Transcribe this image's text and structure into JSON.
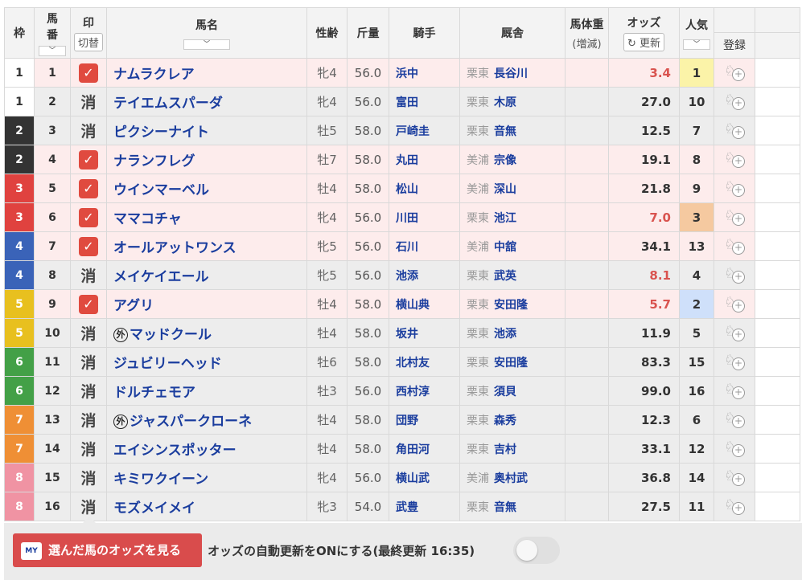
{
  "headers": {
    "waku": "枠",
    "umaban_1": "馬",
    "umaban_2": "番",
    "mark": "印",
    "mark_toggle": "切替",
    "name": "馬名",
    "sexage": "性齢",
    "weight": "斤量",
    "jockey": "騎手",
    "stable": "厩舎",
    "body_weight": "馬体重",
    "body_weight_sub": "(増減)",
    "odds": "オッズ",
    "odds_refresh": "更新",
    "ninki": "人気",
    "register": "登録"
  },
  "sort_arrow": "﹀",
  "refresh_icon": "↻",
  "check_glyph": "✓",
  "gai_glyph": "外",
  "horse_glyph": "♘",
  "plus_glyph": "+",
  "colors": {
    "waku": {
      "1": "#ffffff",
      "2": "#333333",
      "3": "#e0423f",
      "4": "#3a63b8",
      "5": "#e8c01f",
      "6": "#43a047",
      "7": "#ef8f35",
      "8": "#f093a3"
    },
    "mark_check": "#e04a3f",
    "odds_hot": "#d9534f",
    "ninki_1": "#fbf3a8",
    "ninki_2": "#cfe0fa",
    "ninki_3": "#f5c9a0"
  },
  "horses": [
    {
      "waku": "1",
      "num": "1",
      "mark": "check",
      "name": "ナムラクレア",
      "foreign": false,
      "sexage": "牝4",
      "weight": "56.0",
      "jockey": "浜中",
      "loc": "栗東",
      "trainer": "長谷川",
      "odds": "3.4",
      "hot": true,
      "ninki": "1"
    },
    {
      "waku": "1",
      "num": "2",
      "mark": "消",
      "name": "テイエムスパーダ",
      "foreign": false,
      "sexage": "牝4",
      "weight": "56.0",
      "jockey": "富田",
      "loc": "栗東",
      "trainer": "木原",
      "odds": "27.0",
      "hot": false,
      "ninki": "10"
    },
    {
      "waku": "2",
      "num": "3",
      "mark": "消",
      "name": "ピクシーナイト",
      "foreign": false,
      "sexage": "牡5",
      "weight": "58.0",
      "jockey": "戸崎圭",
      "loc": "栗東",
      "trainer": "音無",
      "odds": "12.5",
      "hot": false,
      "ninki": "7"
    },
    {
      "waku": "2",
      "num": "4",
      "mark": "check",
      "name": "ナランフレグ",
      "foreign": false,
      "sexage": "牡7",
      "weight": "58.0",
      "jockey": "丸田",
      "loc": "美浦",
      "trainer": "宗像",
      "odds": "19.1",
      "hot": false,
      "ninki": "8"
    },
    {
      "waku": "3",
      "num": "5",
      "mark": "check",
      "name": "ウインマーベル",
      "foreign": false,
      "sexage": "牡4",
      "weight": "58.0",
      "jockey": "松山",
      "loc": "美浦",
      "trainer": "深山",
      "odds": "21.8",
      "hot": false,
      "ninki": "9"
    },
    {
      "waku": "3",
      "num": "6",
      "mark": "check",
      "name": "ママコチャ",
      "foreign": false,
      "sexage": "牝4",
      "weight": "56.0",
      "jockey": "川田",
      "loc": "栗東",
      "trainer": "池江",
      "odds": "7.0",
      "hot": true,
      "ninki": "3"
    },
    {
      "waku": "4",
      "num": "7",
      "mark": "check",
      "name": "オールアットワンス",
      "foreign": false,
      "sexage": "牝5",
      "weight": "56.0",
      "jockey": "石川",
      "loc": "美浦",
      "trainer": "中舘",
      "odds": "34.1",
      "hot": false,
      "ninki": "13"
    },
    {
      "waku": "4",
      "num": "8",
      "mark": "消",
      "name": "メイケイエール",
      "foreign": false,
      "sexage": "牝5",
      "weight": "56.0",
      "jockey": "池添",
      "loc": "栗東",
      "trainer": "武英",
      "odds": "8.1",
      "hot": true,
      "ninki": "4"
    },
    {
      "waku": "5",
      "num": "9",
      "mark": "check",
      "name": "アグリ",
      "foreign": false,
      "sexage": "牡4",
      "weight": "58.0",
      "jockey": "横山典",
      "loc": "栗東",
      "trainer": "安田隆",
      "odds": "5.7",
      "hot": true,
      "ninki": "2"
    },
    {
      "waku": "5",
      "num": "10",
      "mark": "消",
      "name": "マッドクール",
      "foreign": true,
      "sexage": "牡4",
      "weight": "58.0",
      "jockey": "坂井",
      "loc": "栗東",
      "trainer": "池添",
      "odds": "11.9",
      "hot": false,
      "ninki": "5"
    },
    {
      "waku": "6",
      "num": "11",
      "mark": "消",
      "name": "ジュビリーヘッド",
      "foreign": false,
      "sexage": "牡6",
      "weight": "58.0",
      "jockey": "北村友",
      "loc": "栗東",
      "trainer": "安田隆",
      "odds": "83.3",
      "hot": false,
      "ninki": "15"
    },
    {
      "waku": "6",
      "num": "12",
      "mark": "消",
      "name": "ドルチェモア",
      "foreign": false,
      "sexage": "牡3",
      "weight": "56.0",
      "jockey": "西村淳",
      "loc": "栗東",
      "trainer": "須貝",
      "odds": "99.0",
      "hot": false,
      "ninki": "16"
    },
    {
      "waku": "7",
      "num": "13",
      "mark": "消",
      "name": "ジャスパークローネ",
      "foreign": true,
      "sexage": "牡4",
      "weight": "58.0",
      "jockey": "団野",
      "loc": "栗東",
      "trainer": "森秀",
      "odds": "12.3",
      "hot": false,
      "ninki": "6"
    },
    {
      "waku": "7",
      "num": "14",
      "mark": "消",
      "name": "エイシンスポッター",
      "foreign": false,
      "sexage": "牡4",
      "weight": "58.0",
      "jockey": "角田河",
      "loc": "栗東",
      "trainer": "吉村",
      "odds": "33.1",
      "hot": false,
      "ninki": "12"
    },
    {
      "waku": "8",
      "num": "15",
      "mark": "消",
      "name": "キミワクイーン",
      "foreign": false,
      "sexage": "牝4",
      "weight": "56.0",
      "jockey": "横山武",
      "loc": "美浦",
      "trainer": "奥村武",
      "odds": "36.8",
      "hot": false,
      "ninki": "14"
    },
    {
      "waku": "8",
      "num": "16",
      "mark": "消",
      "name": "モズメイメイ",
      "foreign": false,
      "sexage": "牝3",
      "weight": "54.0",
      "jockey": "武豊",
      "loc": "栗東",
      "trainer": "音無",
      "odds": "27.5",
      "hot": false,
      "ninki": "11"
    }
  ],
  "footer": {
    "button_icon": "MY",
    "button_label": "選んだ馬のオッズを見る",
    "auto_update_text": "オッズの自動更新をONにする(最終更新 16:35)",
    "toggle_on": false
  }
}
